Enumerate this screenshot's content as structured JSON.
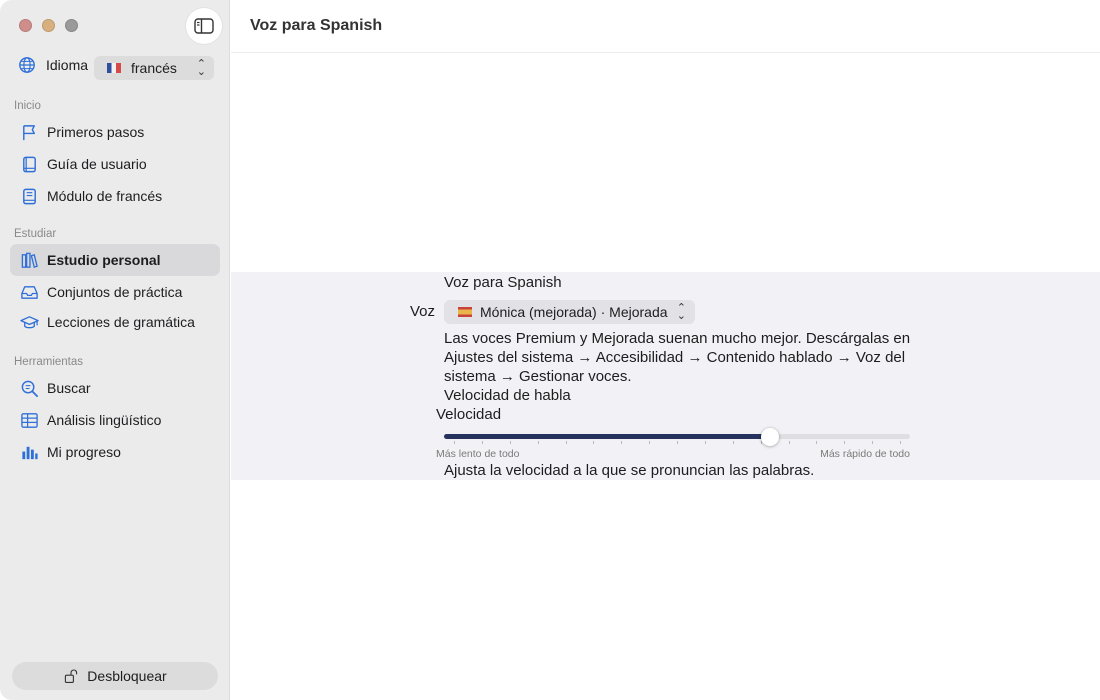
{
  "window": {
    "title": "Voz para Spanish"
  },
  "sidebar": {
    "language": {
      "label": "Idioma",
      "selected": "francés",
      "flag": "french-flag"
    },
    "sections": [
      {
        "title": "Inicio",
        "items": [
          {
            "label": "Primeros pasos",
            "icon": "flag-icon"
          },
          {
            "label": "Guía de usuario",
            "icon": "book-icon"
          },
          {
            "label": "Módulo de francés",
            "icon": "module-book-icon"
          }
        ]
      },
      {
        "title": "Estudiar",
        "items": [
          {
            "label": "Estudio personal",
            "icon": "books-icon",
            "active": true
          },
          {
            "label": "Conjuntos de práctica",
            "icon": "tray-icon"
          },
          {
            "label": "Lecciones de gramática",
            "icon": "graduation-cap-icon"
          }
        ]
      },
      {
        "title": "Herramientas",
        "items": [
          {
            "label": "Buscar",
            "icon": "search-text-icon"
          },
          {
            "label": "Análisis lingüístico",
            "icon": "table-icon"
          },
          {
            "label": "Mi progreso",
            "icon": "bar-chart-icon"
          }
        ]
      }
    ],
    "unlock_label": "Desbloquear"
  },
  "voice_panel": {
    "heading": "Voz para Spanish",
    "voice_label": "Voz",
    "voice_selected": "Mónica (mejorada) · Mejorada",
    "voice_flag": "spanish-flag",
    "help_text": "Las voces Premium y Mejorada suenan mucho mejor. Descárgalas en Ajustes del sistema → Accesibilidad → Contenido hablado → Voz del sistema → Gestionar voces.",
    "rate_heading": "Velocidad de habla",
    "rate_label": "Velocidad",
    "rate_value": 0.7,
    "rate_ticks": 17,
    "rate_min_label": "Más lento de todo",
    "rate_max_label": "Más rápido de todo",
    "rate_help": "Ajusta la velocidad a la que se pronuncian las palabras."
  },
  "colors": {
    "accent": "#2e6fd8",
    "slider_fill": "#27335f",
    "sidebar_bg": "#ebebeb",
    "panel_bg": "#f2f2f6"
  }
}
